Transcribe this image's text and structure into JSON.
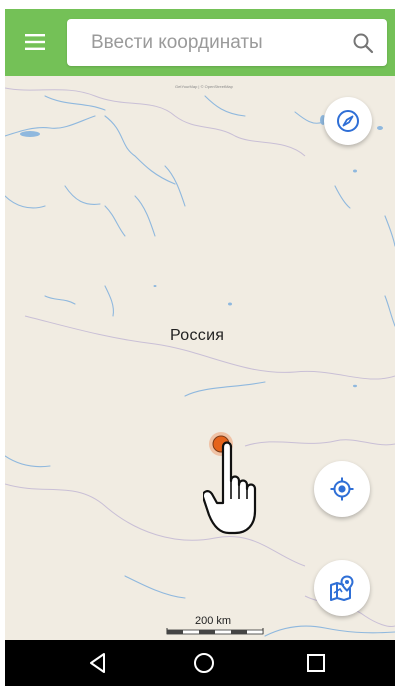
{
  "search": {
    "placeholder": "Ввести координаты"
  },
  "map": {
    "attribution": "GetYourMap | © OpenStreetMap",
    "country_label": "Россия",
    "scale_label": "200 km"
  },
  "colors": {
    "topbar": "#74c157",
    "accent_blue": "#2f6fd6",
    "marker": "#e5631b",
    "map_bg": "#f1ece2",
    "water": "#8fb8de"
  },
  "icons": {
    "menu": "menu-icon",
    "search": "search-icon",
    "compass": "compass-icon",
    "locate": "crosshair-icon",
    "map": "map-pin-icon",
    "back": "back-triangle-icon",
    "home": "home-circle-icon",
    "recent": "recent-square-icon"
  }
}
